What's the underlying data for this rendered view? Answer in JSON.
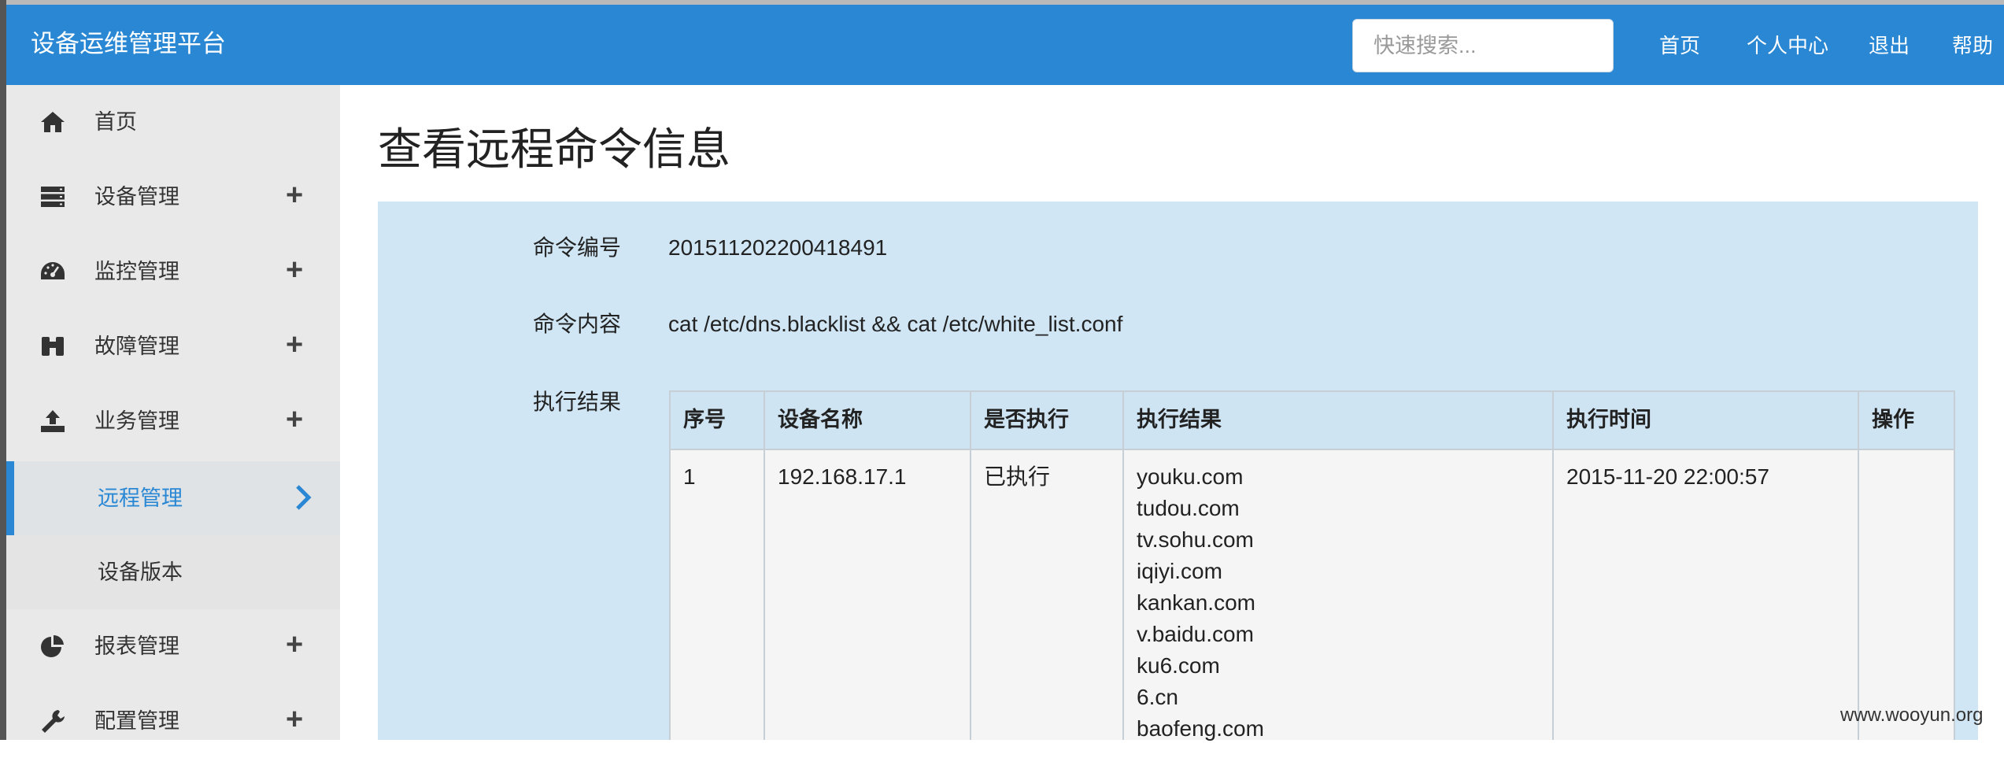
{
  "header": {
    "brand": "设备运维管理平台",
    "search_placeholder": "快速搜索...",
    "nav": [
      "首页",
      "个人中心",
      "退出",
      "帮助"
    ]
  },
  "sidebar": {
    "items": [
      {
        "label": "首页",
        "icon": "home-icon"
      },
      {
        "label": "设备管理",
        "icon": "server-icon",
        "expand": "+"
      },
      {
        "label": "监控管理",
        "icon": "dashboard-icon",
        "expand": "+"
      },
      {
        "label": "故障管理",
        "icon": "binoculars-icon",
        "expand": "+"
      },
      {
        "label": "业务管理",
        "icon": "upload-icon",
        "expand": "+"
      },
      {
        "label": "远程管理",
        "active": true
      },
      {
        "label": "设备版本"
      },
      {
        "label": "报表管理",
        "icon": "pie-chart-icon",
        "expand": "+"
      },
      {
        "label": "配置管理",
        "icon": "wrench-icon",
        "expand": "+"
      }
    ]
  },
  "main": {
    "title": "查看远程命令信息",
    "fields": {
      "cmd_no_label": "命令编号",
      "cmd_no": "201511202200418491",
      "cmd_content_label": "命令内容",
      "cmd_content": "cat /etc/dns.blacklist && cat /etc/white_list.conf",
      "result_label": "执行结果"
    },
    "table": {
      "columns": [
        "序号",
        "设备名称",
        "是否执行",
        "执行结果",
        "执行时间",
        "操作"
      ],
      "rows": [
        {
          "index": "1",
          "device": "192.168.17.1",
          "executed": "已执行",
          "results": [
            "youku.com",
            "tudou.com",
            "tv.sohu.com",
            "iqiyi.com",
            "kankan.com",
            "v.baidu.com",
            "ku6.com",
            "6.cn",
            "baofeng.com"
          ],
          "time": "2015-11-20 22:00:57",
          "action": ""
        }
      ]
    }
  },
  "watermark": "www.wooyun.org",
  "colors": {
    "primary": "#2987d4",
    "panel": "#d0e6f4",
    "sidebar": "#e9e9e9"
  }
}
